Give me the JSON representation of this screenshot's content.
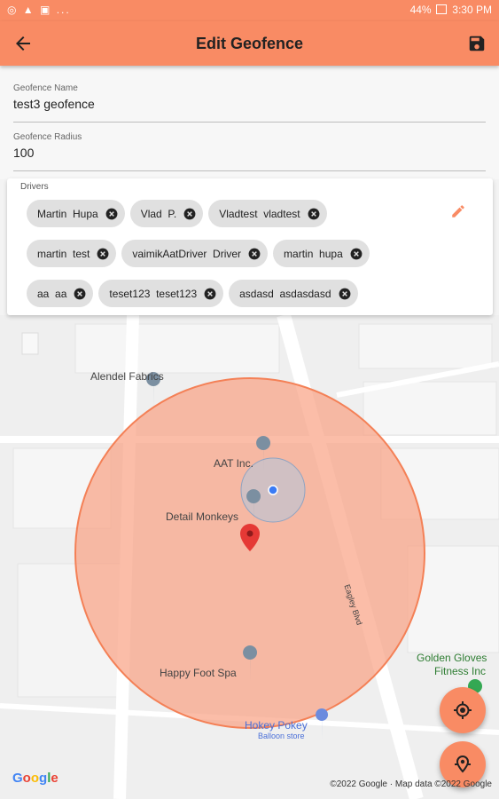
{
  "status_bar": {
    "left_icons": "◎ ▲ ▣ ...",
    "battery": "44%",
    "time": "3:30 PM"
  },
  "appbar": {
    "title": "Edit Geofence"
  },
  "form": {
    "name_label": "Geofence Name",
    "name_value": "test3 geofence",
    "radius_label": "Geofence Radius",
    "radius_value": "100"
  },
  "drivers": {
    "label": "Drivers",
    "rows": [
      [
        "Martin  Hupa",
        "Vlad  P.",
        "Vladtest  vladtest"
      ],
      [
        "martin  test",
        "vaimikAatDriver  Driver",
        "martin  hupa"
      ],
      [
        "aa  aa",
        "teset123  teset123",
        "asdasd  asdasdasd"
      ]
    ]
  },
  "map": {
    "pois": {
      "alendel": "Alendel Fabrics",
      "aat": "AAT Inc.",
      "detail": "Detail Monkeys",
      "happy": "Happy Foot Spa",
      "hokey": "Hokey Pokey",
      "hokey_sub": "Balloon store",
      "golden": "Golden Gloves",
      "golden2": "Fitness Inc",
      "street": "Eagley Blvd"
    },
    "google_logo": "Google",
    "copyright": "©2022 Google · Map data ©2022 Google"
  },
  "colors": {
    "accent": "#f98b64",
    "geofence_fill": "#f9a183",
    "pin": "#e53935"
  }
}
